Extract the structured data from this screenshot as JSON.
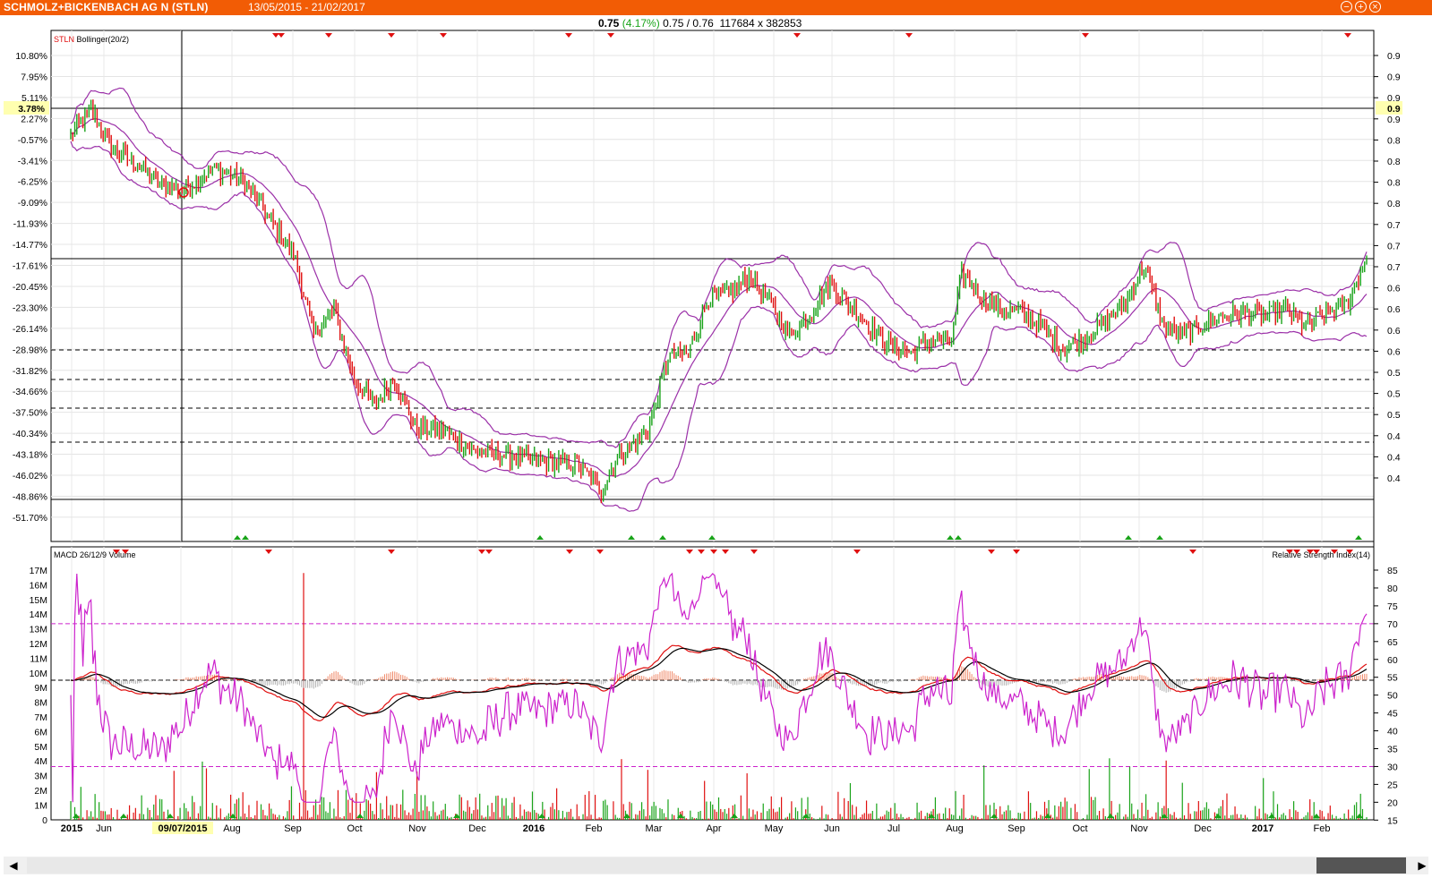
{
  "window": {
    "title": "SCHMOLZ+BICKENBACH AG N (STLN)",
    "date_range": "13/05/2015 - 21/02/2017",
    "buttons": [
      "−",
      "+",
      "×"
    ]
  },
  "quote": {
    "last": "0.75",
    "change": "(4.17%)",
    "bid_ask": "0.75 / 0.76",
    "size": "117684 x 382853"
  },
  "colors": {
    "accent": "#f25c05",
    "up": "#19a319",
    "down": "#e01010",
    "bollinger": "#9b30a8",
    "rsi": "#cc22cc",
    "macd": "#000000",
    "signal": "#e01010"
  },
  "scrollbar": {
    "left_icon": "arrow-left-icon",
    "right_icon": "arrow-right-icon"
  },
  "chart_data": [
    {
      "type": "candlestick",
      "legend": {
        "ticker": "STLN",
        "indicator": "Bollinger(20/2)"
      },
      "y_left_ticks": [
        "10.80%",
        "7.95%",
        "5.11%",
        "2.27%",
        "-0.57%",
        "-3.41%",
        "-6.25%",
        "-9.09%",
        "-11.93%",
        "-14.77%",
        "-17.61%",
        "-20.45%",
        "-23.30%",
        "-26.14%",
        "-28.98%",
        "-31.82%",
        "-34.66%",
        "-37.50%",
        "-40.34%",
        "-43.18%",
        "-46.02%",
        "-48.86%",
        "-51.70%"
      ],
      "y_right_ticks": [
        "0.9",
        "0.9",
        "0.9",
        "0.9",
        "0.8",
        "0.8",
        "0.8",
        "0.8",
        "0.7",
        "0.7",
        "0.7",
        "0.6",
        "0.6",
        "0.6",
        "0.6",
        "0.5",
        "0.5",
        "0.5",
        "0.4",
        "0.4",
        "0.4"
      ],
      "crosshair": {
        "left_label": "3.78%",
        "right_label": "0.9",
        "x_label": "09/07/2015"
      },
      "x_labels": [
        "2015",
        "Jun",
        "Aug",
        "Sep",
        "Oct",
        "Nov",
        "Dec",
        "2016",
        "Feb",
        "Mar",
        "Apr",
        "May",
        "Jun",
        "Jul",
        "Aug",
        "Sep",
        "Oct",
        "Nov",
        "Dec",
        "2017",
        "Feb"
      ],
      "series_anchors": {
        "close_pct": [
          [
            0,
            0.0
          ],
          [
            10,
            3.5
          ],
          [
            20,
            -1.5
          ],
          [
            35,
            -4.5
          ],
          [
            45,
            -6.8
          ],
          [
            55,
            -7.5
          ],
          [
            70,
            -4.5
          ],
          [
            85,
            -6.0
          ],
          [
            100,
            -12.0
          ],
          [
            110,
            -16.0
          ],
          [
            120,
            -27.0
          ],
          [
            130,
            -23.5
          ],
          [
            140,
            -33.0
          ],
          [
            150,
            -36.5
          ],
          [
            160,
            -33.0
          ],
          [
            170,
            -39.5
          ],
          [
            185,
            -40.0
          ],
          [
            200,
            -43.0
          ],
          [
            215,
            -43.2
          ],
          [
            230,
            -44.0
          ],
          [
            250,
            -44.5
          ],
          [
            262,
            -48.0
          ],
          [
            270,
            -43.5
          ],
          [
            285,
            -40.0
          ],
          [
            295,
            -30.0
          ],
          [
            305,
            -29.5
          ],
          [
            315,
            -22.0
          ],
          [
            325,
            -21.5
          ],
          [
            335,
            -19.0
          ],
          [
            345,
            -22.5
          ],
          [
            355,
            -27.0
          ],
          [
            365,
            -24.0
          ],
          [
            375,
            -20.0
          ],
          [
            385,
            -23.0
          ],
          [
            395,
            -26.0
          ],
          [
            405,
            -28.5
          ],
          [
            415,
            -29.5
          ],
          [
            425,
            -27.5
          ],
          [
            435,
            -28.0
          ],
          [
            440,
            -18.5
          ],
          [
            450,
            -22.0
          ],
          [
            460,
            -23.5
          ],
          [
            470,
            -24.0
          ],
          [
            480,
            -26.0
          ],
          [
            490,
            -29.0
          ],
          [
            500,
            -27.5
          ],
          [
            510,
            -25.5
          ],
          [
            520,
            -23.0
          ],
          [
            530,
            -17.5
          ],
          [
            540,
            -26.0
          ],
          [
            550,
            -27.0
          ],
          [
            560,
            -25.5
          ],
          [
            570,
            -24.5
          ],
          [
            580,
            -24.0
          ],
          [
            590,
            -24.5
          ],
          [
            600,
            -23.5
          ],
          [
            610,
            -26.0
          ],
          [
            620,
            -24.0
          ],
          [
            630,
            -23.0
          ],
          [
            640,
            -16.5
          ]
        ]
      }
    },
    {
      "type": "line",
      "legend_left": "MACD 26/12/9 Volume",
      "legend_right": "Relative Strength Index(14)",
      "y_left_ticks": [
        "17M",
        "16M",
        "15M",
        "14M",
        "13M",
        "12M",
        "11M",
        "10M",
        "9M",
        "8M",
        "7M",
        "6M",
        "5M",
        "4M",
        "3M",
        "2M",
        "1M",
        "0"
      ],
      "y_right_ticks": [
        "85",
        "80",
        "75",
        "70",
        "65",
        "60",
        "55",
        "50",
        "45",
        "40",
        "35",
        "30",
        "25",
        "20",
        "15"
      ],
      "rsi_levels": [
        70,
        30
      ]
    }
  ]
}
